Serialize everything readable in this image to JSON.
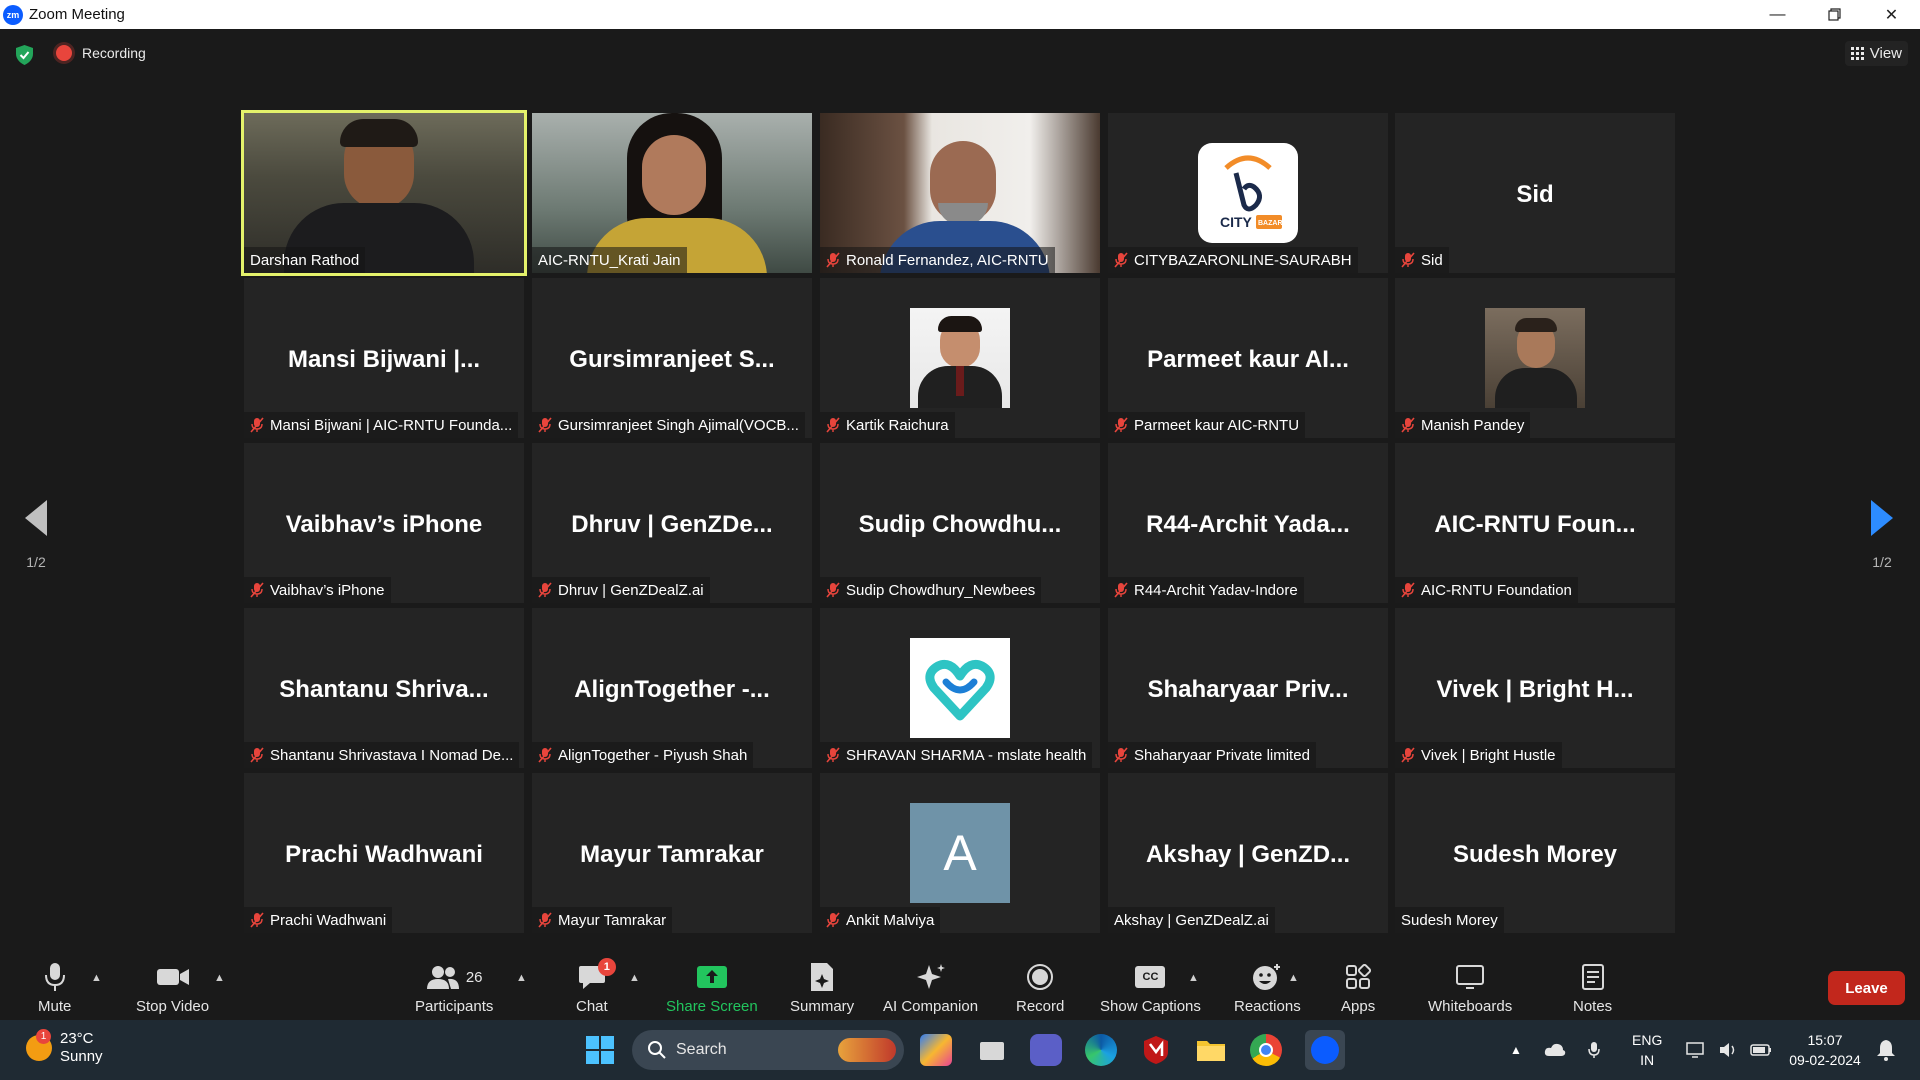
{
  "window": {
    "title": "Zoom Meeting",
    "logo_text": "zm"
  },
  "header": {
    "recording": "Recording",
    "view": "View"
  },
  "pagination": {
    "left": "1/2",
    "right": "1/2"
  },
  "tiles": [
    {
      "big": "",
      "label": "Darshan Rathod"
    },
    {
      "big": "",
      "label": "AIC-RNTU_Krati Jain"
    },
    {
      "big": "",
      "label": "Ronald Fernandez, AIC-RNTU"
    },
    {
      "big": "",
      "label": "CITYBAZARONLINE-SAURABH"
    },
    {
      "big": "Sid",
      "label": "Sid"
    },
    {
      "big": "Mansi Bijwani |...",
      "label": "Mansi Bijwani | AIC-RNTU Founda..."
    },
    {
      "big": "Gursimranjeet S...",
      "label": "Gursimranjeet Singh Ajimal(VOCB..."
    },
    {
      "big": "",
      "label": "Kartik Raichura"
    },
    {
      "big": "Parmeet kaur AI...",
      "label": "Parmeet kaur AIC-RNTU"
    },
    {
      "big": "",
      "label": "Manish Pandey"
    },
    {
      "big": "Vaibhav’s iPhone",
      "label": "Vaibhav’s iPhone"
    },
    {
      "big": "Dhruv | GenZDe...",
      "label": "Dhruv | GenZDealZ.ai"
    },
    {
      "big": "Sudip Chowdhu...",
      "label": "Sudip Chowdhury_Newbees"
    },
    {
      "big": "R44-Archit Yada...",
      "label": "R44-Archit Yadav-Indore"
    },
    {
      "big": "AIC-RNTU Foun...",
      "label": "AIC-RNTU Foundation"
    },
    {
      "big": "Shantanu Shriva...",
      "label": "Shantanu Shrivastava I Nomad De..."
    },
    {
      "big": "AlignTogether -...",
      "label": "AlignTogether - Piyush Shah"
    },
    {
      "big": "",
      "label": "SHRAVAN SHARMA - mslate health"
    },
    {
      "big": "Shaharyaar Priv...",
      "label": "Shaharyaar Private limited"
    },
    {
      "big": "Vivek | Bright H...",
      "label": "Vivek | Bright Hustle"
    },
    {
      "big": "Prachi Wadhwani",
      "label": "Prachi Wadhwani"
    },
    {
      "big": "Mayur Tamrakar",
      "label": "Mayur Tamrakar"
    },
    {
      "big": "",
      "label": "Ankit Malviya",
      "avatar_letter": "A"
    },
    {
      "big": "Akshay | GenZD...",
      "label": "Akshay | GenZDealZ.ai"
    },
    {
      "big": "Sudesh Morey",
      "label": "Sudesh Morey"
    }
  ],
  "citybazar_logo_text": "CITY BAZAR",
  "toolbar": {
    "mute": "Mute",
    "stop_video": "Stop Video",
    "participants": "Participants",
    "participants_count": "26",
    "chat": "Chat",
    "chat_badge": "1",
    "share_screen": "Share Screen",
    "summary": "Summary",
    "ai_companion": "AI Companion",
    "record": "Record",
    "show_captions": "Show Captions",
    "cc": "CC",
    "reactions": "Reactions",
    "apps": "Apps",
    "whiteboards": "Whiteboards",
    "notes": "Notes",
    "leave": "Leave"
  },
  "taskbar": {
    "temperature": "23°C",
    "weather": "Sunny",
    "weather_badge": "1",
    "search": "Search",
    "lang_top": "ENG",
    "lang_bottom": "IN",
    "time": "15:07",
    "date": "09-02-2024"
  },
  "colors": {
    "active_speaker": "#e4f26b",
    "share_screen": "#22c55e",
    "leave": "#c2271c",
    "muted_icon": "#e8453c",
    "zoom_blue": "#0b5cff"
  }
}
